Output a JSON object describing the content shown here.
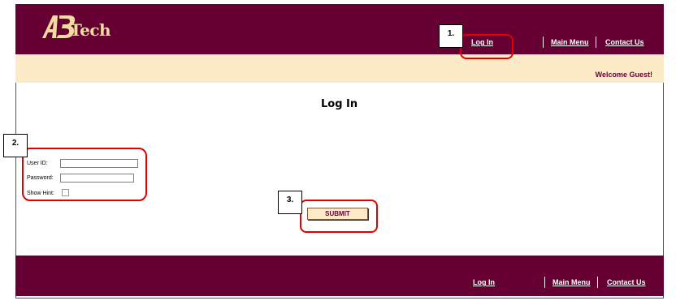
{
  "brand": {
    "logo_text": "Tech"
  },
  "header": {
    "nav": {
      "login": "Log In",
      "main_menu": "Main Menu",
      "contact": "Contact Us"
    }
  },
  "banner": {
    "welcome": "Welcome Guest!"
  },
  "main": {
    "title": "Log In",
    "form": {
      "user_id_label": "User ID:",
      "user_id_value": "",
      "password_label": "Password:",
      "password_value": "",
      "show_hint_label": "Show Hint:",
      "show_hint_checked": false,
      "submit_label": "SUBMIT"
    }
  },
  "footer": {
    "nav": {
      "login": "Log In",
      "main_menu": "Main Menu",
      "contact": "Contact Us"
    }
  },
  "annotations": {
    "step1": "1.",
    "step2": "2.",
    "step3": "3."
  },
  "colors": {
    "brand": "#660033",
    "banner": "#fdebc8",
    "callout": "#e00000"
  }
}
